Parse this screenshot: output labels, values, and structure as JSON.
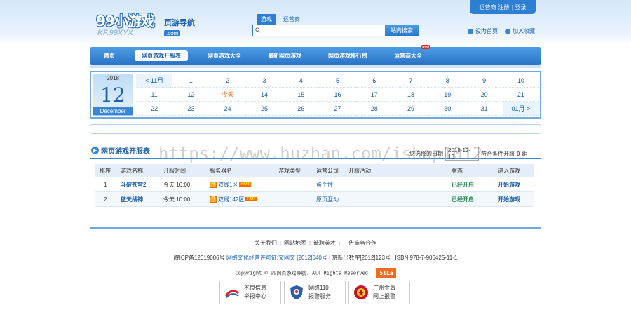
{
  "header": {
    "logo_main": "99小游戏",
    "logo_sub": "页游导航",
    "logo_url": "KF.99XYX",
    "logo_com": ".com",
    "top_links": [
      "运营商",
      "注册",
      "登录"
    ],
    "search_tabs": [
      "游戏",
      "运营商"
    ],
    "search_placeholder": "",
    "search_button": "站内搜索",
    "set_home": "设为首页",
    "add_favorite": "加入收藏"
  },
  "nav": {
    "items": [
      "首页",
      "网页游戏开服表",
      "网页游戏大全",
      "最新网页游戏",
      "网页游戏排行榜",
      "运营商大全"
    ],
    "new_badge": "new"
  },
  "calendar": {
    "year": "2018",
    "day": "12",
    "month": "December",
    "cells": [
      "< 11月",
      "1",
      "2",
      "3",
      "4",
      "5",
      "6",
      "7",
      "8",
      "9",
      "10",
      "11",
      "12",
      "今天",
      "14",
      "15",
      "16",
      "17",
      "18",
      "19",
      "20",
      "21",
      "22",
      "23",
      "24",
      "25",
      "26",
      "27",
      "28",
      "29",
      "30",
      "31",
      "01月 >"
    ],
    "today_label": "今天"
  },
  "server_list": {
    "title": "网页游戏开服表",
    "filter_label": "您选择的日期",
    "filter_date": "2018-12-13",
    "filter_match": "符合条件开服",
    "filter_count": "0",
    "filter_unit": "组",
    "columns": [
      "排序",
      "游戏名称",
      "开服时间",
      "服务器名",
      "游戏类型",
      "运营公司",
      "开服活动",
      "状态",
      "进入游戏"
    ],
    "rows": [
      {
        "rank": "1",
        "game": "斗破苍穹2",
        "time": "今天 16:00",
        "server": "双线1区",
        "hot": "HOT",
        "type": "",
        "company": "蛋个性",
        "activity": "",
        "status": "已经开启",
        "enter": "开始游戏"
      },
      {
        "rank": "2",
        "game": "傲天战神",
        "time": "今天 10:00",
        "server": "双线142区",
        "hot": "HOT",
        "type": "",
        "company": "原页互动",
        "activity": "",
        "status": "已经开启",
        "enter": "开始游戏"
      }
    ]
  },
  "footer": {
    "links": [
      "关于我们",
      "网站地图",
      "诚聘英才",
      "广告商务合作"
    ],
    "icp_prefix": "皖ICP备12019006号",
    "icp_link": "网络文化经营许可证:文网文 [2012]040号",
    "icp_suffix": "京新出数字[2012]123号",
    "isbn": "ISBN 978-7-900425-11-1",
    "copyright": "Copyright © 99网页游戏导航. All Rights Reserved.",
    "stat_badge": "51La",
    "badges": [
      {
        "line1": "不良信息",
        "line2": "举报中心",
        "color": "#d9232e"
      },
      {
        "line1": "网络110",
        "line2": "报警服务",
        "color": "#2d5ea8"
      },
      {
        "line1": "广州金盾",
        "line2": "网上报警",
        "color": "#c8102e"
      }
    ]
  },
  "watermark": "https://www.huzhan.com/ishop1012"
}
